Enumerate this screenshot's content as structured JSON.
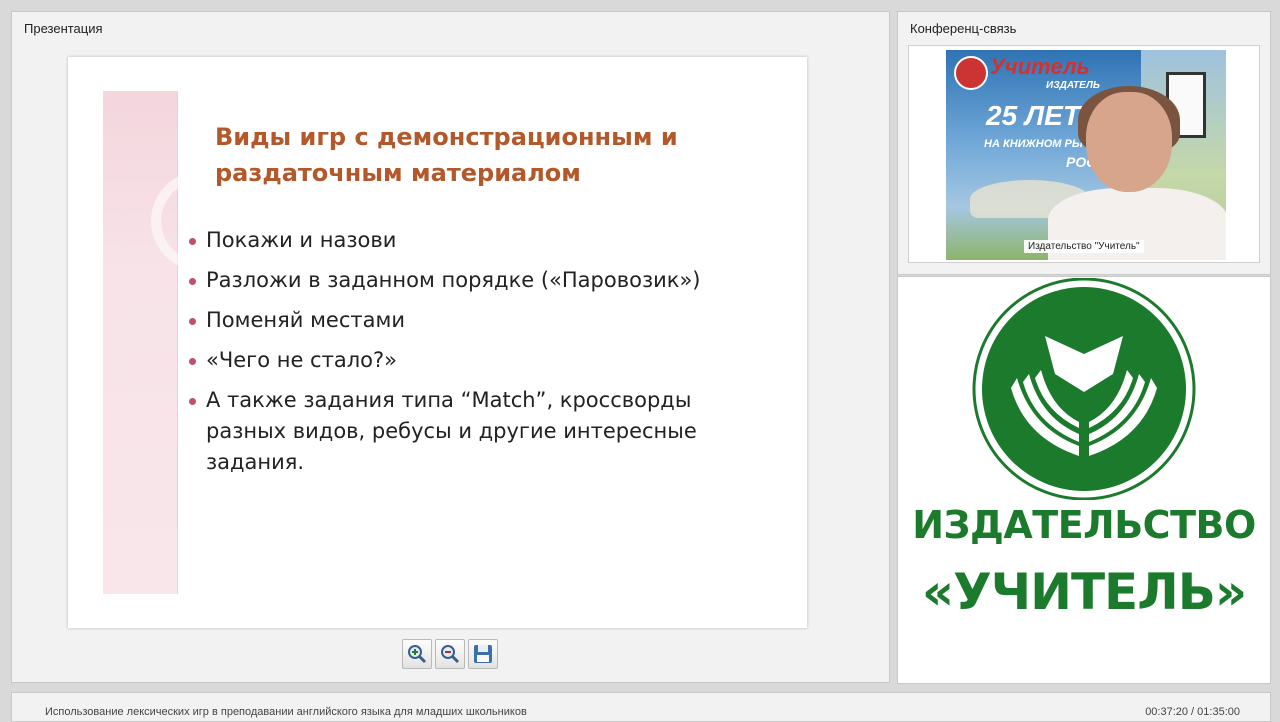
{
  "presentation": {
    "panel_title": "Презентация",
    "slide": {
      "heading_line1": "Виды игр с демонстрационным и",
      "heading_line2": "раздаточным материалом",
      "bullets": [
        "Покажи и назови",
        "Разложи в заданном порядке («Паровозик»)",
        "Поменяй местами",
        "«Чего не стало?»",
        "А также задания типа “Match”, кроссворды разных видов, ребусы и другие интересные задания."
      ]
    },
    "toolbar": {
      "zoom_in_icon": "zoom-in-icon",
      "zoom_out_icon": "zoom-out-icon",
      "save_icon": "floppy-disk-icon"
    }
  },
  "conference": {
    "panel_title": "Конференц-связь",
    "caption": "Издательство \"Учитель\"",
    "banner": {
      "brand": "Учитель",
      "sub": "ИЗДАТЕЛЬ",
      "years": "25 ЛЕТ",
      "line": "НА КНИЖНОМ РЫ",
      "country": "РОСС"
    }
  },
  "logo": {
    "line1": "ИЗДАТЕЛЬСТВО",
    "line2": "«УЧИТЕЛЬ»",
    "color": "#1c7a2d"
  },
  "footer": {
    "title": "Использование лексических игр в преподавании английского языка для младших школьников",
    "time": "00:37:20 / 01:35:00"
  }
}
